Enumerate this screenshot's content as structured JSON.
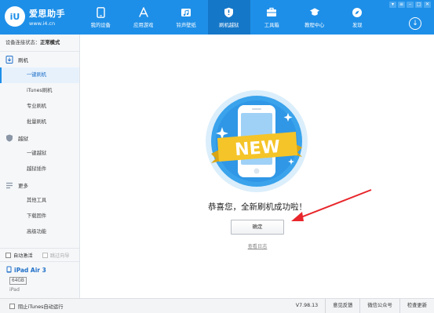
{
  "app": {
    "logo_mark": "iU",
    "name": "爱思助手",
    "url": "www.i4.cn"
  },
  "nav": [
    {
      "label": "我的设备",
      "icon": "phone-icon",
      "active": false
    },
    {
      "label": "应用游戏",
      "icon": "app-store-icon",
      "active": false
    },
    {
      "label": "铃声壁纸",
      "icon": "music-wallpaper-icon",
      "active": false
    },
    {
      "label": "刷机越狱",
      "icon": "shield-icon",
      "active": true
    },
    {
      "label": "工具箱",
      "icon": "toolbox-icon",
      "active": false
    },
    {
      "label": "教程中心",
      "icon": "graduation-cap-icon",
      "active": false
    },
    {
      "label": "发现",
      "icon": "compass-icon",
      "active": false
    }
  ],
  "window_controls": [
    "▾",
    "≡",
    "–",
    "□",
    "✕"
  ],
  "download_glyph": "↓",
  "sidebar": {
    "status_prefix": "设备连接状态：",
    "status_value": "正常模式",
    "sections": [
      {
        "label": "刷机",
        "icon": "flash-icon",
        "items": [
          "一键刷机",
          "iTunes刷机",
          "专业刷机",
          "批量刷机"
        ]
      },
      {
        "label": "越狱",
        "icon": "jailbreak-icon",
        "items": [
          "一键越狱",
          "越狱插件"
        ]
      },
      {
        "label": "更多",
        "icon": "menu-icon",
        "items": [
          "其他工具",
          "下载固件",
          "高级功能"
        ]
      }
    ],
    "active_item": "一键刷机",
    "auto_activate": "自动激活",
    "skip_guide": "跳过向导",
    "device": {
      "name": "iPad Air 3",
      "capacity": "64GB",
      "type": "iPad"
    }
  },
  "main": {
    "badge_text": "NEW",
    "success_message": "恭喜您，全新刷机成功啦！",
    "confirm_button": "确定",
    "view_log_link": "查看日志"
  },
  "statusbar": {
    "block_itunes": "阻止iTunes自动运行",
    "version": "V7.98.13",
    "feedback": "意见反馈",
    "wechat": "微信公众号",
    "check_update": "检查更新"
  },
  "colors": {
    "topbar": "#1e8fe8",
    "topbar_active": "#1577c8",
    "accent": "#1e6fc8",
    "arrow": "#e8262b",
    "ribbon": "#f5c428"
  }
}
